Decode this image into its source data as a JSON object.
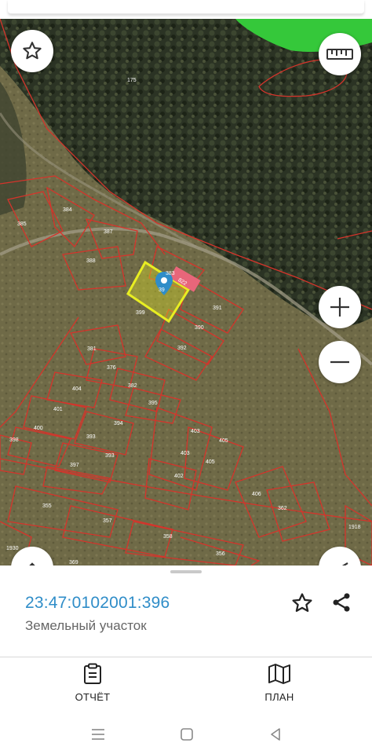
{
  "map": {
    "parcel_labels": [
      "175",
      "384",
      "385",
      "387",
      "388",
      "383",
      "399",
      "391",
      "390",
      "392",
      "381",
      "376",
      "404",
      "382",
      "395",
      "401",
      "394",
      "400",
      "393",
      "398",
      "393",
      "397",
      "403",
      "405",
      "403",
      "405",
      "402",
      "406",
      "362",
      "355",
      "357",
      "358",
      "356",
      "1918",
      "1930",
      "369"
    ],
    "road_label": "822",
    "selected_parcel_label": "39",
    "controls": {
      "favorite_icon": "star-outline-icon",
      "ruler_icon": "ruler-icon",
      "zoom_in_icon": "plus-icon",
      "zoom_out_icon": "minus-icon",
      "collapse_icon": "chevron-up-icon",
      "location_icon": "navigation-arrow-icon"
    },
    "colors": {
      "boundary": "#d5342b",
      "selected_fill": "#e8ee22",
      "marker": "#2f8dc8"
    }
  },
  "details": {
    "cadastral_number": "23:47:0102001:396",
    "object_type": "Земельный участок"
  },
  "tabs": [
    {
      "label": "ОТЧЁТ",
      "icon": "clipboard-icon"
    },
    {
      "label": "ПЛАН",
      "icon": "map-icon"
    }
  ],
  "system_nav": {
    "menu_icon": "menu-icon",
    "home_icon": "home-square-icon",
    "back_icon": "back-triangle-icon"
  }
}
